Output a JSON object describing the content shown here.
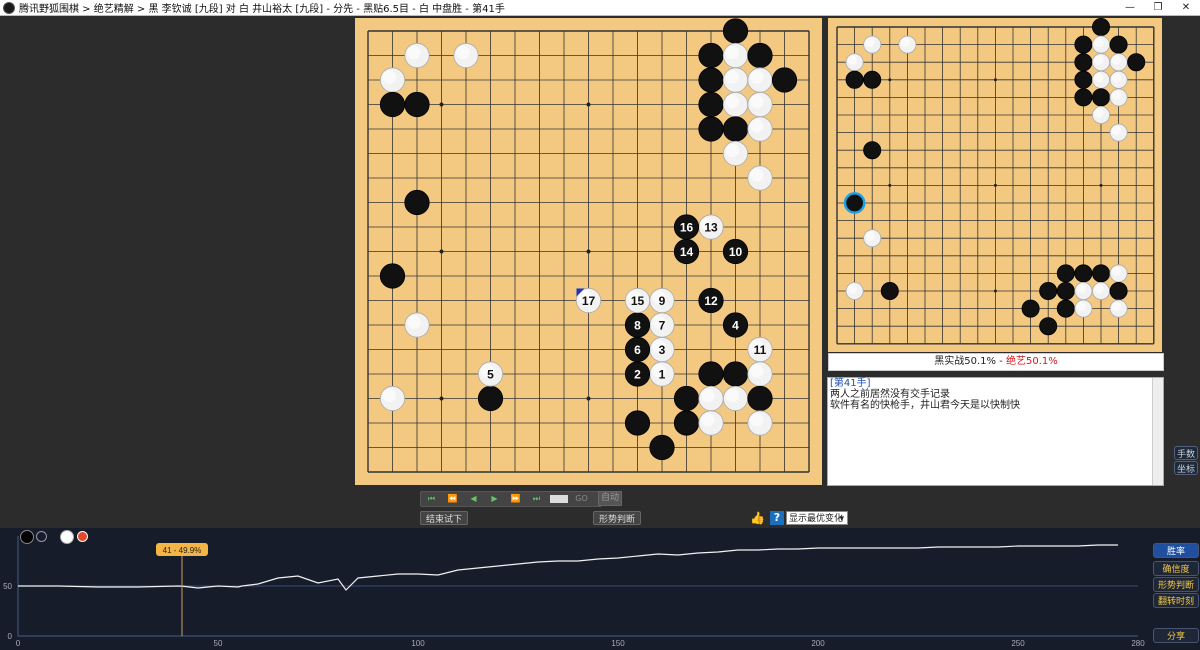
{
  "window": {
    "title": "腾讯野狐围棋 > 绝艺精解 > 黑 李钦诚 [九段] 对 白 井山裕太 [九段] - 分先 - 黑贴6.5目 - 白 中盘胜 - 第41手",
    "min_icon": "—",
    "max_icon": "❐",
    "close_icon": "✕"
  },
  "main_board": {
    "size": 19,
    "stones": [
      {
        "c": "W",
        "col": 3,
        "row": 2
      },
      {
        "c": "W",
        "col": 5,
        "row": 2
      },
      {
        "c": "W",
        "col": 2,
        "row": 3
      },
      {
        "c": "B",
        "col": 2,
        "row": 4
      },
      {
        "c": "B",
        "col": 3,
        "row": 4
      },
      {
        "c": "B",
        "col": 16,
        "row": 1
      },
      {
        "c": "B",
        "col": 15,
        "row": 2
      },
      {
        "c": "W",
        "col": 16,
        "row": 2
      },
      {
        "c": "B",
        "col": 17,
        "row": 2
      },
      {
        "c": "B",
        "col": 15,
        "row": 3
      },
      {
        "c": "W",
        "col": 16,
        "row": 3
      },
      {
        "c": "W",
        "col": 17,
        "row": 3
      },
      {
        "c": "B",
        "col": 18,
        "row": 3
      },
      {
        "c": "B",
        "col": 15,
        "row": 4
      },
      {
        "c": "W",
        "col": 16,
        "row": 4
      },
      {
        "c": "W",
        "col": 17,
        "row": 4
      },
      {
        "c": "B",
        "col": 15,
        "row": 5
      },
      {
        "c": "B",
        "col": 16,
        "row": 5
      },
      {
        "c": "W",
        "col": 17,
        "row": 5
      },
      {
        "c": "W",
        "col": 16,
        "row": 6
      },
      {
        "c": "W",
        "col": 17,
        "row": 7
      },
      {
        "c": "B",
        "col": 3,
        "row": 8
      },
      {
        "c": "B",
        "col": 2,
        "row": 11
      },
      {
        "c": "W",
        "col": 3,
        "row": 13
      },
      {
        "c": "W",
        "col": 2,
        "row": 16
      },
      {
        "c": "B",
        "col": 6,
        "row": 16
      },
      {
        "c": "B",
        "col": 15,
        "row": 15
      },
      {
        "c": "B",
        "col": 16,
        "row": 15
      },
      {
        "c": "W",
        "col": 17,
        "row": 15
      },
      {
        "c": "B",
        "col": 14,
        "row": 16
      },
      {
        "c": "W",
        "col": 15,
        "row": 16
      },
      {
        "c": "W",
        "col": 16,
        "row": 16
      },
      {
        "c": "B",
        "col": 17,
        "row": 16
      },
      {
        "c": "B",
        "col": 12,
        "row": 17
      },
      {
        "c": "B",
        "col": 14,
        "row": 17
      },
      {
        "c": "W",
        "col": 15,
        "row": 17
      },
      {
        "c": "W",
        "col": 17,
        "row": 17
      },
      {
        "c": "B",
        "col": 13,
        "row": 18
      },
      {
        "c": "W",
        "col": 13,
        "row": 15,
        "n": "1"
      },
      {
        "c": "B",
        "col": 12,
        "row": 15,
        "n": "2"
      },
      {
        "c": "W",
        "col": 13,
        "row": 14,
        "n": "3"
      },
      {
        "c": "B",
        "col": 16,
        "row": 13,
        "n": "4"
      },
      {
        "c": "W",
        "col": 6,
        "row": 15,
        "n": "5"
      },
      {
        "c": "B",
        "col": 12,
        "row": 14,
        "n": "6"
      },
      {
        "c": "W",
        "col": 13,
        "row": 13,
        "n": "7"
      },
      {
        "c": "B",
        "col": 12,
        "row": 13,
        "n": "8"
      },
      {
        "c": "W",
        "col": 13,
        "row": 12,
        "n": "9"
      },
      {
        "c": "B",
        "col": 16,
        "row": 10,
        "n": "10"
      },
      {
        "c": "W",
        "col": 17,
        "row": 14,
        "n": "11"
      },
      {
        "c": "B",
        "col": 15,
        "row": 12,
        "n": "12"
      },
      {
        "c": "W",
        "col": 15,
        "row": 9,
        "n": "13"
      },
      {
        "c": "B",
        "col": 14,
        "row": 10,
        "n": "14"
      },
      {
        "c": "W",
        "col": 12,
        "row": 12,
        "n": "15"
      },
      {
        "c": "B",
        "col": 14,
        "row": 9,
        "n": "16"
      },
      {
        "c": "W",
        "col": 10,
        "row": 12,
        "n": "17"
      }
    ]
  },
  "mini_board": {
    "size": 19,
    "stones": [
      {
        "c": "W",
        "col": 2,
        "row": 3
      },
      {
        "c": "W",
        "col": 3,
        "row": 2
      },
      {
        "c": "W",
        "col": 5,
        "row": 2
      },
      {
        "c": "B",
        "col": 2,
        "row": 4
      },
      {
        "c": "B",
        "col": 3,
        "row": 4
      },
      {
        "c": "B",
        "col": 16,
        "row": 1
      },
      {
        "c": "B",
        "col": 15,
        "row": 2
      },
      {
        "c": "W",
        "col": 16,
        "row": 2
      },
      {
        "c": "B",
        "col": 17,
        "row": 2
      },
      {
        "c": "B",
        "col": 15,
        "row": 3
      },
      {
        "c": "W",
        "col": 16,
        "row": 3
      },
      {
        "c": "W",
        "col": 17,
        "row": 3
      },
      {
        "c": "B",
        "col": 18,
        "row": 3
      },
      {
        "c": "B",
        "col": 15,
        "row": 4
      },
      {
        "c": "W",
        "col": 16,
        "row": 4
      },
      {
        "c": "W",
        "col": 17,
        "row": 4
      },
      {
        "c": "B",
        "col": 15,
        "row": 5
      },
      {
        "c": "B",
        "col": 16,
        "row": 5
      },
      {
        "c": "W",
        "col": 17,
        "row": 5
      },
      {
        "c": "W",
        "col": 16,
        "row": 6
      },
      {
        "c": "W",
        "col": 17,
        "row": 7
      },
      {
        "c": "B",
        "col": 3,
        "row": 8
      },
      {
        "c": "B",
        "col": 2,
        "row": 11,
        "last": true
      },
      {
        "c": "W",
        "col": 3,
        "row": 13
      },
      {
        "c": "W",
        "col": 2,
        "row": 16
      },
      {
        "c": "B",
        "col": 4,
        "row": 16
      },
      {
        "c": "B",
        "col": 15,
        "row": 15
      },
      {
        "c": "B",
        "col": 16,
        "row": 15
      },
      {
        "c": "B",
        "col": 14,
        "row": 15
      },
      {
        "c": "W",
        "col": 17,
        "row": 15
      },
      {
        "c": "B",
        "col": 14,
        "row": 16
      },
      {
        "c": "W",
        "col": 15,
        "row": 16
      },
      {
        "c": "W",
        "col": 16,
        "row": 16
      },
      {
        "c": "B",
        "col": 17,
        "row": 16
      },
      {
        "c": "B",
        "col": 13,
        "row": 16
      },
      {
        "c": "B",
        "col": 12,
        "row": 17
      },
      {
        "c": "B",
        "col": 14,
        "row": 17
      },
      {
        "c": "W",
        "col": 15,
        "row": 17
      },
      {
        "c": "W",
        "col": 17,
        "row": 17
      },
      {
        "c": "B",
        "col": 13,
        "row": 18
      }
    ]
  },
  "winrate": {
    "black_label": "黑实战50.1% - ",
    "ai_label": "绝艺50.1%",
    "ai_color": "#d01818"
  },
  "comment": {
    "move": "[第41手]",
    "lines": [
      "两人之前居然没有交手记录",
      "软件有名的快枪手，井山君今天是以快制快"
    ]
  },
  "side_buttons": {
    "move_hand": "手数",
    "coord": "坐标"
  },
  "controls": {
    "icons": [
      "⏮",
      "⏪",
      "◀",
      "▶",
      "⏩",
      "⏭"
    ],
    "go_label": "GO",
    "auto_label": "自动",
    "end_trial_label": "结束试下",
    "judge_label": "形势判断",
    "thumb_icon": "👍",
    "help_label": "?",
    "select_value": "显示最优变化",
    "select_arrow": "▾"
  },
  "chart_data": {
    "type": "line",
    "title": "",
    "xlim": [
      0,
      280
    ],
    "ylim": [
      0,
      100
    ],
    "x_ticks": [
      "0",
      "50",
      "100",
      "150",
      "200",
      "250",
      "280"
    ],
    "y_ticks": [
      "0",
      "50"
    ],
    "marker": {
      "x": 41,
      "label": "41 - 49.9%"
    },
    "series": [
      {
        "x": [
          0,
          10,
          20,
          30,
          40,
          41,
          45,
          50,
          55,
          56,
          60,
          65,
          70,
          75,
          80,
          82,
          85,
          90,
          95,
          100,
          105,
          110,
          115,
          120,
          125,
          130,
          135,
          140,
          145,
          150,
          155,
          160,
          165,
          170,
          175,
          180,
          185,
          190,
          195,
          200,
          205,
          210,
          215,
          220,
          225,
          230,
          235,
          240,
          245,
          250,
          255,
          260,
          265,
          270,
          275
        ],
        "values": [
          50,
          50,
          49,
          49,
          50,
          49.9,
          48,
          50,
          49,
          50,
          52,
          58,
          60,
          53,
          57,
          46,
          58,
          60,
          62,
          62,
          61,
          66,
          68,
          70,
          72,
          74,
          75,
          75,
          77,
          78,
          80,
          82,
          81,
          83,
          84,
          86,
          86,
          87,
          87,
          88,
          88,
          88,
          88,
          88,
          88,
          89,
          89,
          89,
          89,
          90,
          90,
          90,
          90,
          91,
          91
        ]
      }
    ]
  },
  "chart_buttons": [
    "胜率",
    "确信度",
    "形势判断",
    "翻转时刻"
  ],
  "chart_share": "分享"
}
